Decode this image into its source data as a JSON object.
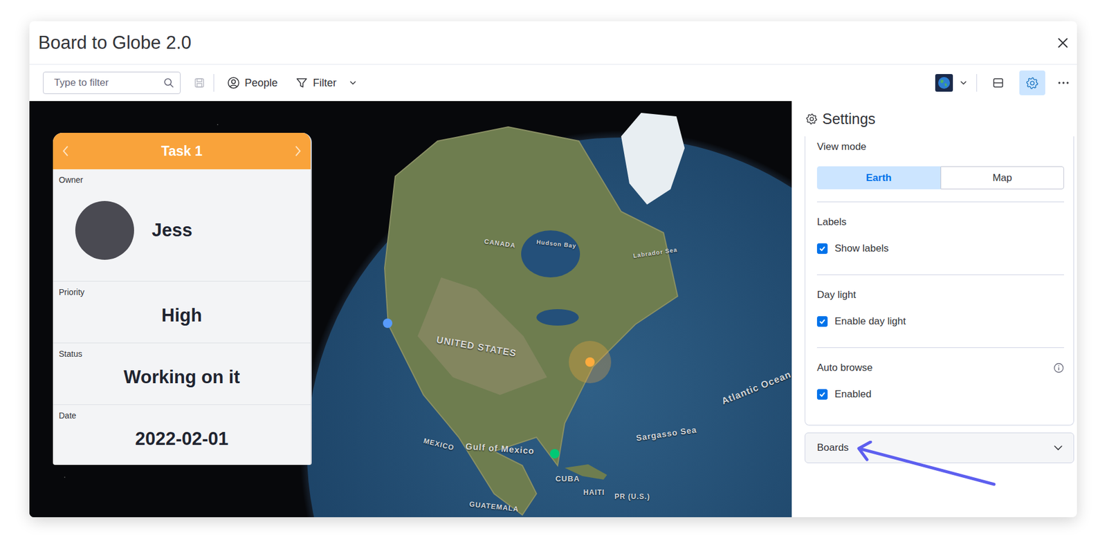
{
  "window": {
    "title": "Board to Globe 2.0"
  },
  "toolbar": {
    "search": {
      "placeholder": "Type to filter"
    },
    "buttons": [
      {
        "label": "People"
      },
      {
        "label": "Filter"
      }
    ],
    "settings_active": true
  },
  "card": {
    "title": "Task 1",
    "fields": [
      {
        "label": "Owner",
        "value": "Jess",
        "kind": "person"
      },
      {
        "label": "Priority",
        "value": "High",
        "kind": "text"
      },
      {
        "label": "Status",
        "value": "Working on it",
        "kind": "text"
      },
      {
        "label": "Date",
        "value": "2022-02-01",
        "kind": "text"
      }
    ]
  },
  "globe": {
    "labels": [
      "CANADA",
      "Hudson Bay",
      "Labrador Sea",
      "UNITED STATES",
      "Atlantic Ocean",
      "Sargasso Sea",
      "Gulf of Mexico",
      "MEXICO",
      "CUBA",
      "HAITI",
      "PR (U.S.)",
      "GUATEMALA"
    ],
    "pins": [
      {
        "color": "#579bfc",
        "selected": false
      },
      {
        "color": "#fdab3d",
        "selected": true
      },
      {
        "color": "#00c875",
        "selected": false
      }
    ]
  },
  "settings": {
    "title": "Settings",
    "view_mode": {
      "label": "View mode",
      "options": [
        {
          "label": "Earth",
          "selected": true
        },
        {
          "label": "Map",
          "selected": false
        }
      ]
    },
    "sections": [
      {
        "title": "Labels",
        "option": "Show labels",
        "checked": true,
        "info": false
      },
      {
        "title": "Day light",
        "option": "Enable day light",
        "checked": true,
        "info": false
      },
      {
        "title": "Auto browse",
        "option": "Enabled",
        "checked": true,
        "info": true
      }
    ],
    "boards": {
      "label": "Boards",
      "expanded": false
    }
  }
}
